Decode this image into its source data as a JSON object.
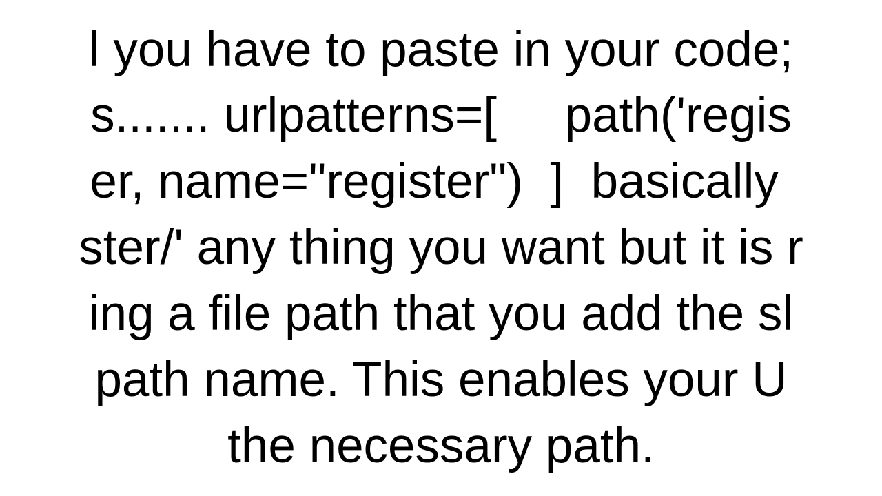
{
  "lines": {
    "l1": "l you have to paste in your code;",
    "l2": "s....... urlpatterns=[     path('regis",
    "l3": "er, name=\"register\")  ]  basically ",
    "l4": "ster/' any thing you want but it is r",
    "l5": "ing a file path that you add the sl",
    "l6": "path name. This enables your U",
    "l7": "the necessary path."
  }
}
